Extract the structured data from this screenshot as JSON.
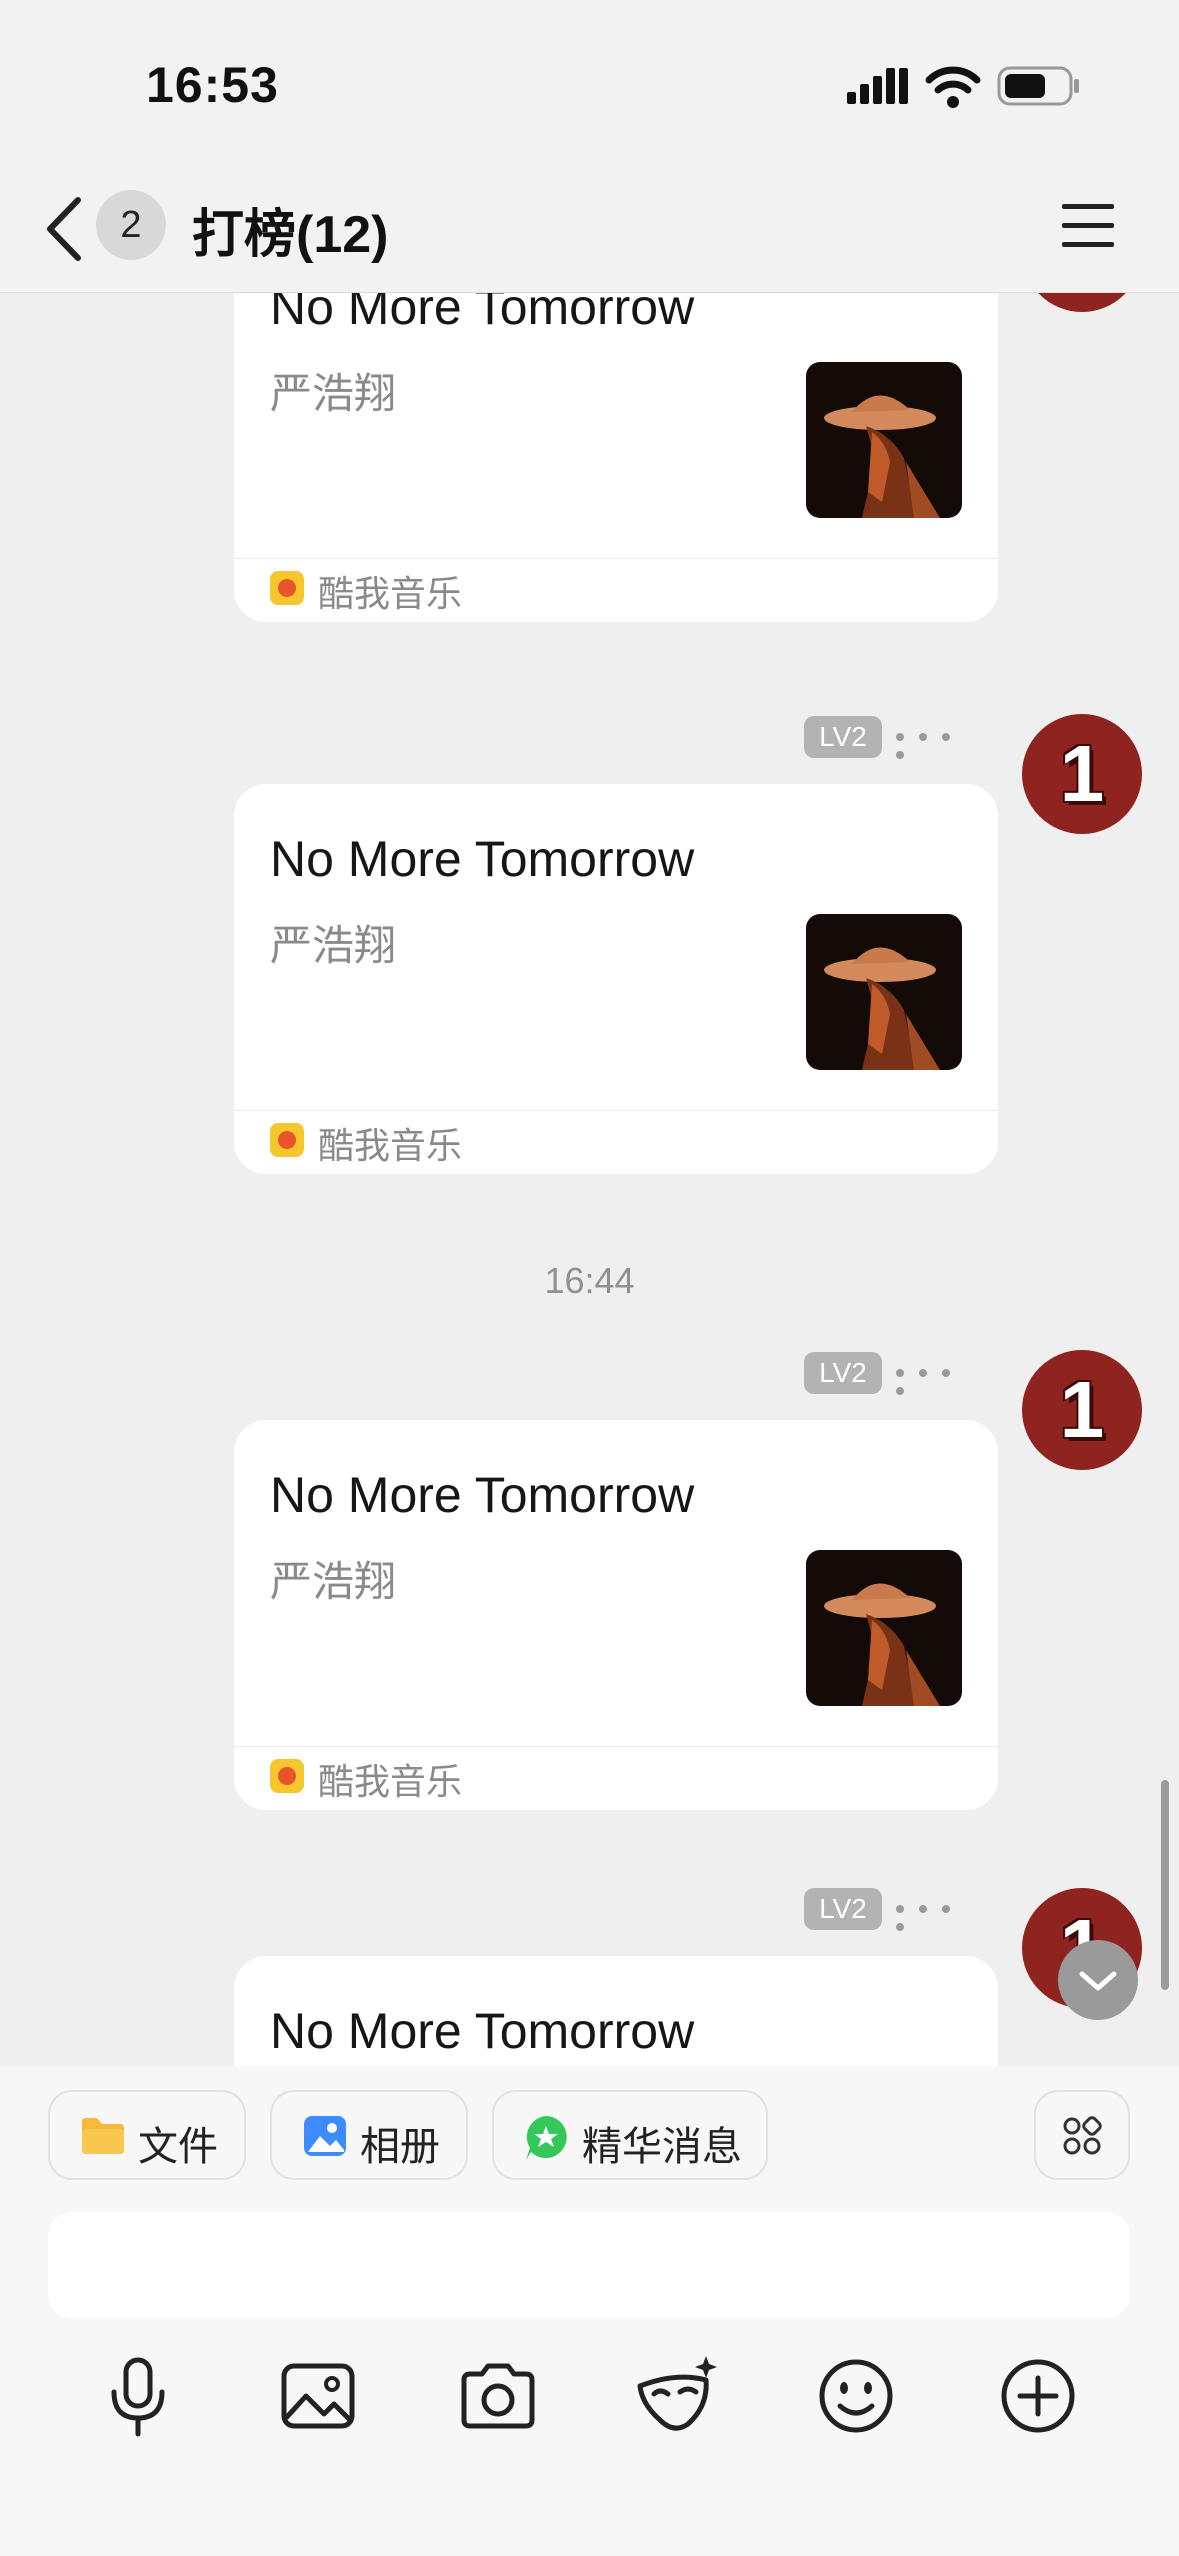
{
  "status_bar": {
    "time": "16:53"
  },
  "header": {
    "unread_count": "2",
    "title": "打榜(12)"
  },
  "messages": [
    {
      "song": "No More Tomorrow",
      "artist": "严浩翔",
      "source": "酷我音乐"
    },
    {
      "level": "LV2",
      "avatar_text": "1",
      "song": "No More Tomorrow",
      "artist": "严浩翔",
      "source": "酷我音乐"
    },
    {
      "level": "LV2",
      "avatar_text": "1",
      "song": "No More Tomorrow",
      "artist": "严浩翔",
      "source": "酷我音乐"
    },
    {
      "level": "LV2",
      "avatar_text": "1",
      "song": "No More Tomorrow"
    }
  ],
  "timestamp": "16:44",
  "quick_actions": {
    "file": "文件",
    "album": "相册",
    "essence": "精华消息"
  },
  "colors": {
    "avatar": "#8e2320",
    "level_badge": "#b3b3b3",
    "file_folder": "#f6b93b",
    "album": "#3d8bff",
    "essence": "#34c759"
  }
}
